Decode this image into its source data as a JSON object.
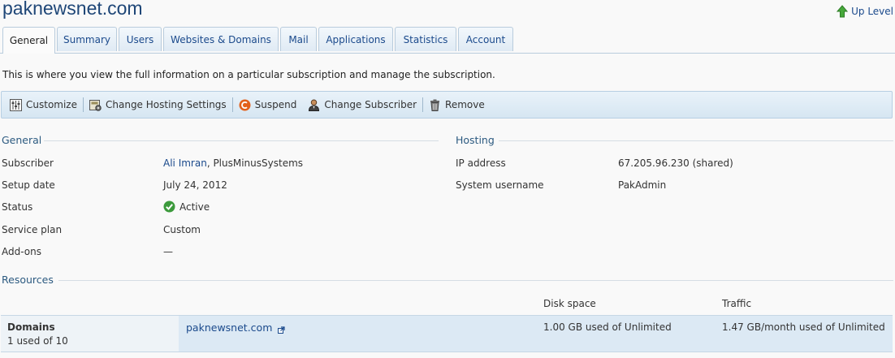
{
  "header": {
    "title": "paknewsnet.com",
    "up_level_label": "Up Level"
  },
  "tabs": [
    {
      "label": "General",
      "active": true
    },
    {
      "label": "Summary"
    },
    {
      "label": "Users"
    },
    {
      "label": "Websites & Domains"
    },
    {
      "label": "Mail"
    },
    {
      "label": "Applications"
    },
    {
      "label": "Statistics"
    },
    {
      "label": "Account"
    }
  ],
  "intro": "This is where you view the full information on a particular subscription and manage the subscription.",
  "toolbar": {
    "customize": "Customize",
    "change_hosting": "Change Hosting Settings",
    "suspend": "Suspend",
    "change_subscriber": "Change Subscriber",
    "remove": "Remove"
  },
  "general": {
    "title": "General",
    "subscriber_label": "Subscriber",
    "subscriber_link": "Ali Imran",
    "subscriber_rest": ", PlusMinusSystems",
    "setup_label": "Setup date",
    "setup_value": "July 24, 2012",
    "status_label": "Status",
    "status_value": "Active",
    "plan_label": "Service plan",
    "plan_value": "Custom",
    "addons_label": "Add-ons",
    "addons_value": "—"
  },
  "hosting": {
    "title": "Hosting",
    "ip_label": "IP address",
    "ip_value": "67.205.96.230 (shared)",
    "user_label": "System username",
    "user_value": "PakAdmin"
  },
  "resources": {
    "title": "Resources",
    "col_disk": "Disk space",
    "col_traffic": "Traffic",
    "row": {
      "name": "Domains",
      "usage": "1 used of 10",
      "domain": "paknewsnet.com",
      "disk": "1.00 GB used of Unlimited",
      "traffic": "1.47 GB/month used of Unlimited"
    }
  },
  "colors": {
    "accent": "#1e4677",
    "section_title": "#2c5a80",
    "status_green": "#3c9a3c",
    "suspend_orange": "#e2601b"
  }
}
